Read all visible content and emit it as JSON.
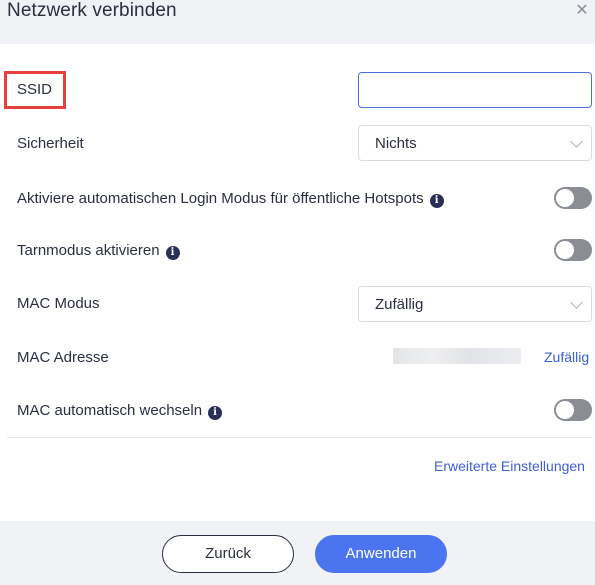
{
  "dialog": {
    "title": "Netzwerk verbinden",
    "close_icon": "close-icon"
  },
  "fields": {
    "ssid": {
      "label": "SSID",
      "value": "",
      "placeholder": ""
    },
    "security": {
      "label": "Sicherheit",
      "selected": "Nichts"
    },
    "auto_login": {
      "label": "Aktiviere automatischen Login Modus für öffentliche Hotspots",
      "enabled": false
    },
    "stealth": {
      "label": "Tarnmodus aktivieren",
      "enabled": false
    },
    "mac_mode": {
      "label": "MAC Modus",
      "selected": "Zufällig"
    },
    "mac_address": {
      "label": "MAC Adresse",
      "action": "Zufällig"
    },
    "mac_auto_change": {
      "label": "MAC automatisch wechseln",
      "enabled": false
    }
  },
  "advanced_link": "Erweiterte Einstellungen",
  "buttons": {
    "back": "Zurück",
    "apply": "Anwenden"
  },
  "colors": {
    "accent": "#4a74f0",
    "highlight": "#e8403a",
    "toggle_off": "#8a8d94"
  }
}
